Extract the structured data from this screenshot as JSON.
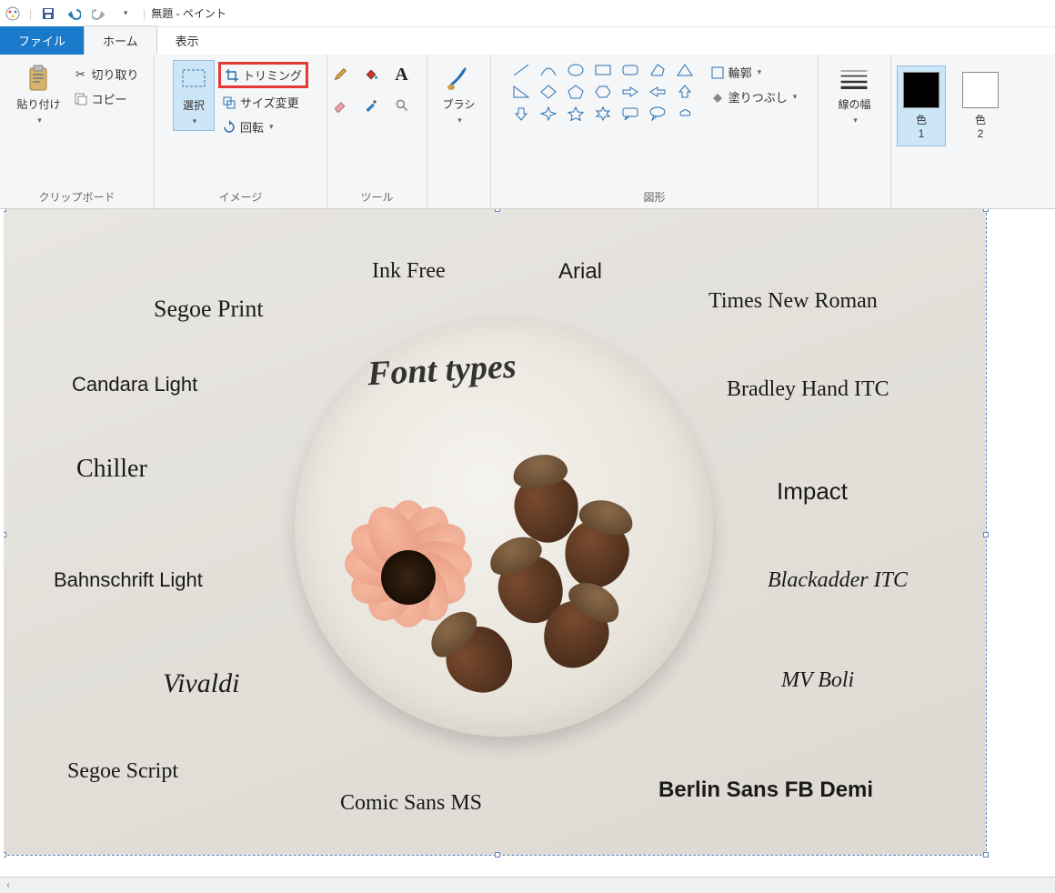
{
  "title": "無題 - ペイント",
  "tabs": {
    "file": "ファイル",
    "home": "ホーム",
    "view": "表示"
  },
  "groups": {
    "clipboard": {
      "label": "クリップボード",
      "paste": "貼り付け",
      "cut": "切り取り",
      "copy": "コピー"
    },
    "image": {
      "label": "イメージ",
      "select": "選択",
      "crop": "トリミング",
      "resize": "サイズ変更",
      "rotate": "回転"
    },
    "tools": {
      "label": "ツール"
    },
    "brushes": {
      "label": "ブラシ"
    },
    "shapes": {
      "label": "図形",
      "outline": "輪郭",
      "fill": "塗りつぶし"
    },
    "linewidth": {
      "label": "線の幅"
    },
    "colors": {
      "c1": "色\n1",
      "c2": "色\n2"
    }
  },
  "canvas_texts": {
    "title": "Font types",
    "ink": "Ink Free",
    "arial": "Arial",
    "times": "Times New Roman",
    "segoeP": "Segoe Print",
    "candara": "Candara Light",
    "bradley": "Bradley Hand ITC",
    "chiller": "Chiller",
    "impact": "Impact",
    "bahn": "Bahnschrift Light",
    "black": "Blackadder ITC",
    "vivaldi": "Vivaldi",
    "mvboli": "MV Boli",
    "segoeS": "Segoe Script",
    "comic": "Comic Sans MS",
    "berlin": "Berlin Sans FB Demi"
  },
  "colors": {
    "c1": "#000000",
    "c2": "#ffffff"
  }
}
